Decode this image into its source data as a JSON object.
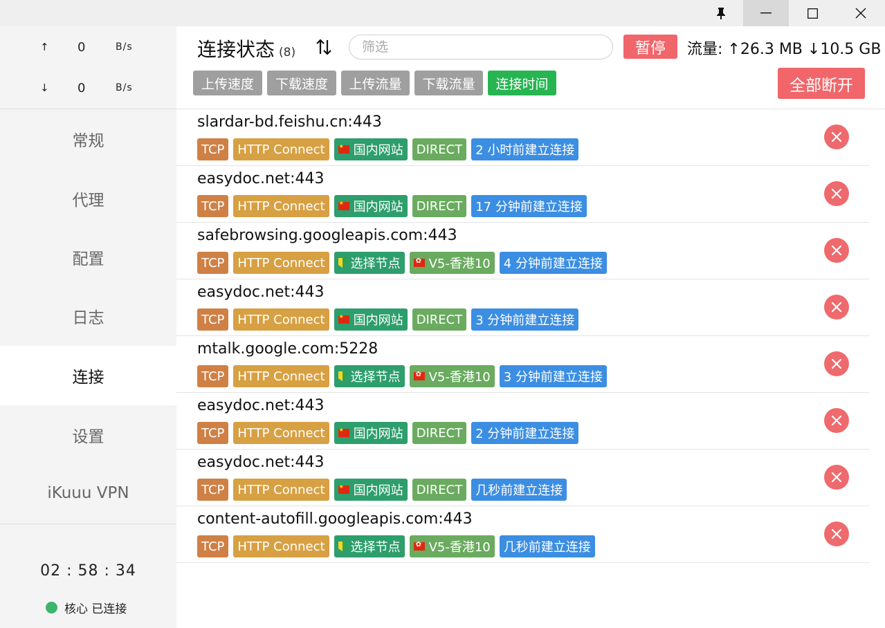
{
  "window": {
    "pin_icon": "pin-icon",
    "minimize_icon": "minimize-icon",
    "maximize_icon": "maximize-icon",
    "close_icon": "close-icon"
  },
  "sidebar": {
    "upload": {
      "arrow": "↑",
      "value": "0",
      "unit": "B/s"
    },
    "download": {
      "arrow": "↓",
      "value": "0",
      "unit": "B/s"
    },
    "nav": [
      {
        "label": "常规"
      },
      {
        "label": "代理"
      },
      {
        "label": "配置"
      },
      {
        "label": "日志"
      },
      {
        "label": "连接",
        "active": true
      },
      {
        "label": "设置"
      },
      {
        "label": "iKuuu VPN"
      }
    ],
    "uptime": "02 : 58 : 34",
    "core_status": "核心 已连接",
    "core_status_color": "#3db46d"
  },
  "header": {
    "title": "连接状态",
    "count": "(8)",
    "filter_placeholder": "筛选",
    "pause_label": "暂停",
    "traffic": "流量: ↑26.3 MB ↓10.5 GB",
    "sort_buttons": [
      {
        "label": "上传速度",
        "active": false
      },
      {
        "label": "下载速度",
        "active": false
      },
      {
        "label": "上传流量",
        "active": false
      },
      {
        "label": "下载流量",
        "active": false
      },
      {
        "label": "连接时间",
        "active": true
      }
    ],
    "disconnect_all_label": "全部断开"
  },
  "colors": {
    "accent_red": "#f0666a",
    "active_green": "#27b552",
    "tag_tcp": "#cf8045",
    "tag_http": "#d7a043",
    "tag_group": "#2d9e6c",
    "tag_node": "#6aab5f",
    "tag_time": "#3b8ee2"
  },
  "connections": [
    {
      "host": "slardar-bd.feishu.cn:443",
      "network": "TCP",
      "type": "HTTP Connect",
      "group": "国内网站",
      "group_flag": "cn",
      "node": "DIRECT",
      "node_flag": "",
      "time": "2 小时前建立连接"
    },
    {
      "host": "easydoc.net:443",
      "network": "TCP",
      "type": "HTTP Connect",
      "group": "国内网站",
      "group_flag": "cn",
      "node": "DIRECT",
      "node_flag": "",
      "time": "17 分钟前建立连接"
    },
    {
      "host": "safebrowsing.googleapis.com:443",
      "network": "TCP",
      "type": "HTTP Connect",
      "group": "选择节点",
      "group_flag": "badge",
      "node": "V5-香港10",
      "node_flag": "hk",
      "time": "4 分钟前建立连接"
    },
    {
      "host": "easydoc.net:443",
      "network": "TCP",
      "type": "HTTP Connect",
      "group": "国内网站",
      "group_flag": "cn",
      "node": "DIRECT",
      "node_flag": "",
      "time": "3 分钟前建立连接"
    },
    {
      "host": "mtalk.google.com:5228",
      "network": "TCP",
      "type": "HTTP Connect",
      "group": "选择节点",
      "group_flag": "badge",
      "node": "V5-香港10",
      "node_flag": "hk",
      "time": "3 分钟前建立连接"
    },
    {
      "host": "easydoc.net:443",
      "network": "TCP",
      "type": "HTTP Connect",
      "group": "国内网站",
      "group_flag": "cn",
      "node": "DIRECT",
      "node_flag": "",
      "time": "2 分钟前建立连接"
    },
    {
      "host": "easydoc.net:443",
      "network": "TCP",
      "type": "HTTP Connect",
      "group": "国内网站",
      "group_flag": "cn",
      "node": "DIRECT",
      "node_flag": "",
      "time": "几秒前建立连接"
    },
    {
      "host": "content-autofill.googleapis.com:443",
      "network": "TCP",
      "type": "HTTP Connect",
      "group": "选择节点",
      "group_flag": "badge",
      "node": "V5-香港10",
      "node_flag": "hk",
      "time": "几秒前建立连接"
    }
  ]
}
